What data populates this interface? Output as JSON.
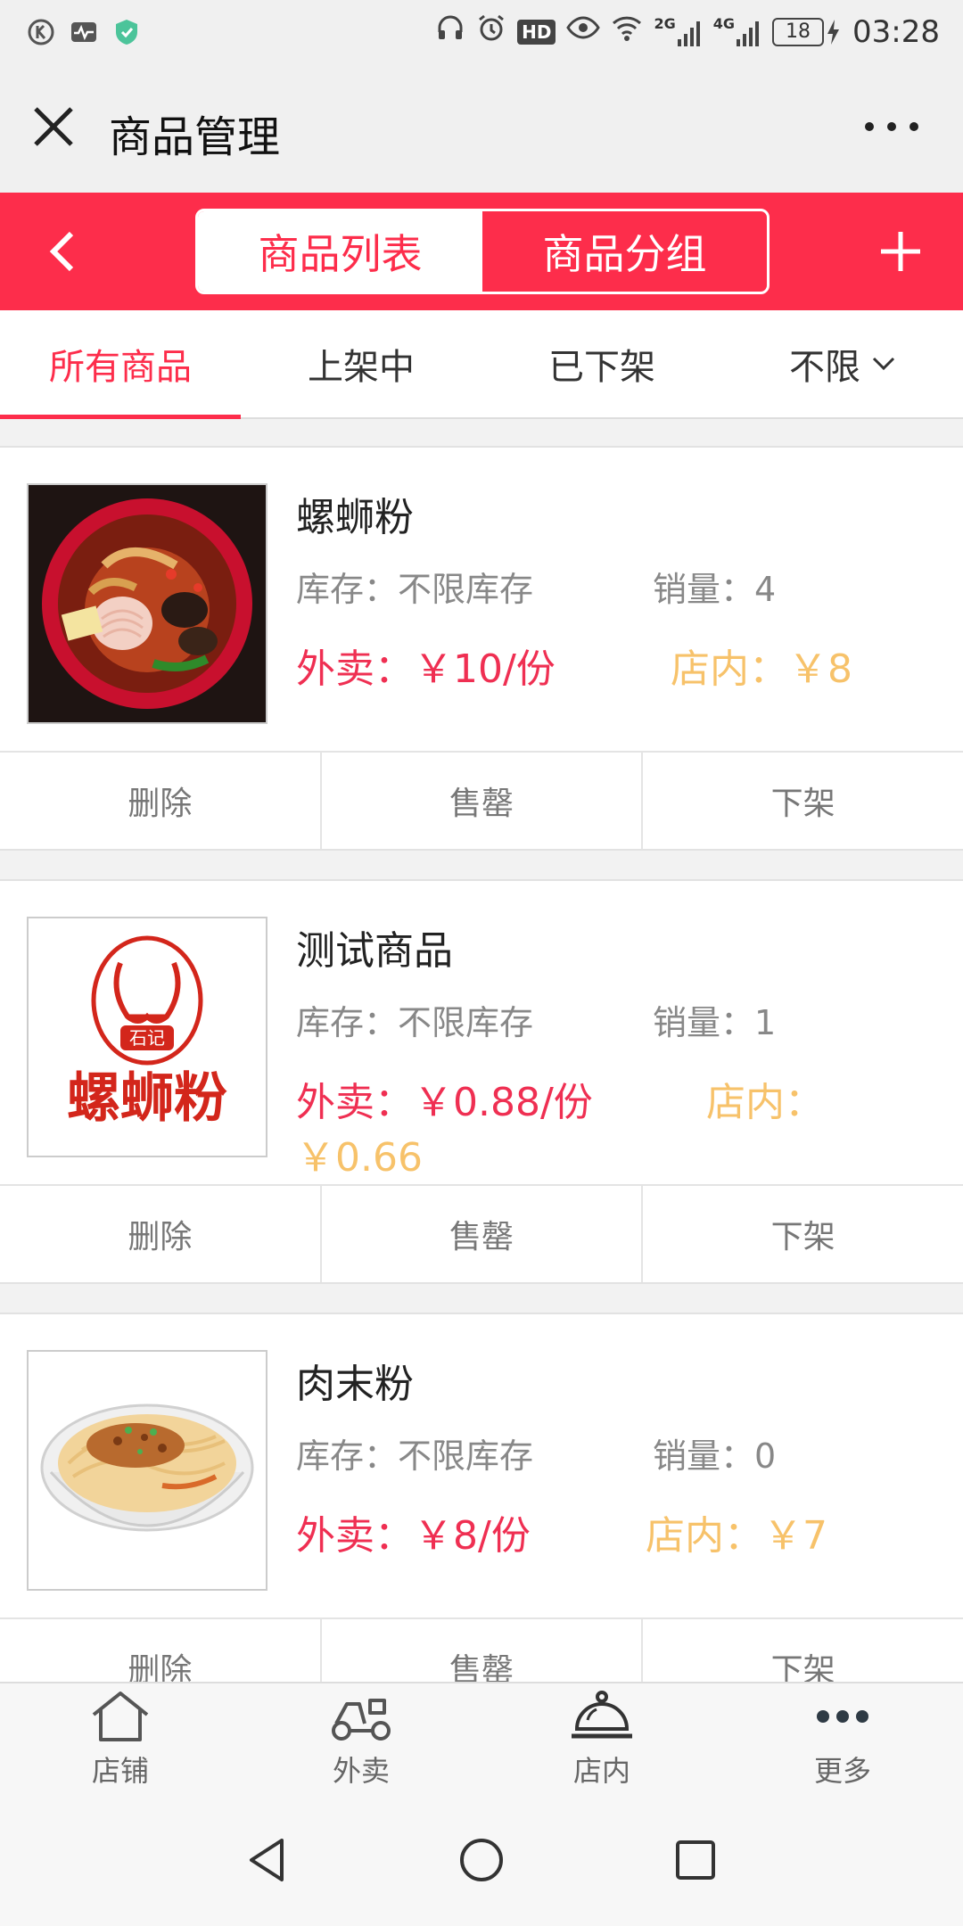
{
  "status_bar": {
    "left_icons": [
      "k-circle-icon",
      "activity-icon",
      "shield-icon"
    ],
    "right_icons": [
      "headphones-icon",
      "alarm-icon",
      "hd-icon",
      "eye-icon",
      "wifi-icon",
      "signal-2g-icon",
      "signal-4g-icon"
    ],
    "net_2g": "2G",
    "net_4g": "4G",
    "hd": "HD",
    "battery": "18",
    "time": "03:28"
  },
  "title_bar": {
    "title": "商品管理"
  },
  "header": {
    "tabs": [
      "商品列表",
      "商品分组"
    ],
    "active_tab": 0,
    "accent": "#fd2d4b"
  },
  "filter_tabs": [
    {
      "label": "所有商品"
    },
    {
      "label": "上架中"
    },
    {
      "label": "已下架"
    },
    {
      "label": "不限"
    }
  ],
  "products": [
    {
      "name": "螺蛳粉",
      "stock": "库存：不限库存",
      "sales": "销量：4",
      "delivery_price": "外卖：￥10/份",
      "instore_price": "店内：￥8",
      "actions": [
        "删除",
        "售罄",
        "下架"
      ]
    },
    {
      "name": "测试商品",
      "stock": "库存：不限库存",
      "sales": "销量：1",
      "delivery_price": "外卖：￥0.88/份",
      "instore_price_line1": "店内：",
      "instore_price_line2": "￥0.66",
      "logo_top_text": "石记",
      "logo_bottom_text": "螺蛳粉",
      "actions": [
        "删除",
        "售罄",
        "下架"
      ]
    },
    {
      "name": "肉末粉",
      "stock": "库存：不限库存",
      "sales": "销量：0",
      "delivery_price": "外卖：￥8/份",
      "instore_price": "店内：￥7",
      "actions": [
        "删除",
        "售罄",
        "下架"
      ]
    }
  ],
  "bottom_nav": [
    {
      "label": "店铺",
      "icon": "store-icon"
    },
    {
      "label": "外卖",
      "icon": "delivery-scooter-icon"
    },
    {
      "label": "店内",
      "icon": "cloche-icon"
    },
    {
      "label": "更多",
      "icon": "more-dots-icon"
    }
  ],
  "colors": {
    "primary_red": "#fd2d4b",
    "delivery_price": "#ef2f52",
    "instore_price": "#f7c26a"
  }
}
